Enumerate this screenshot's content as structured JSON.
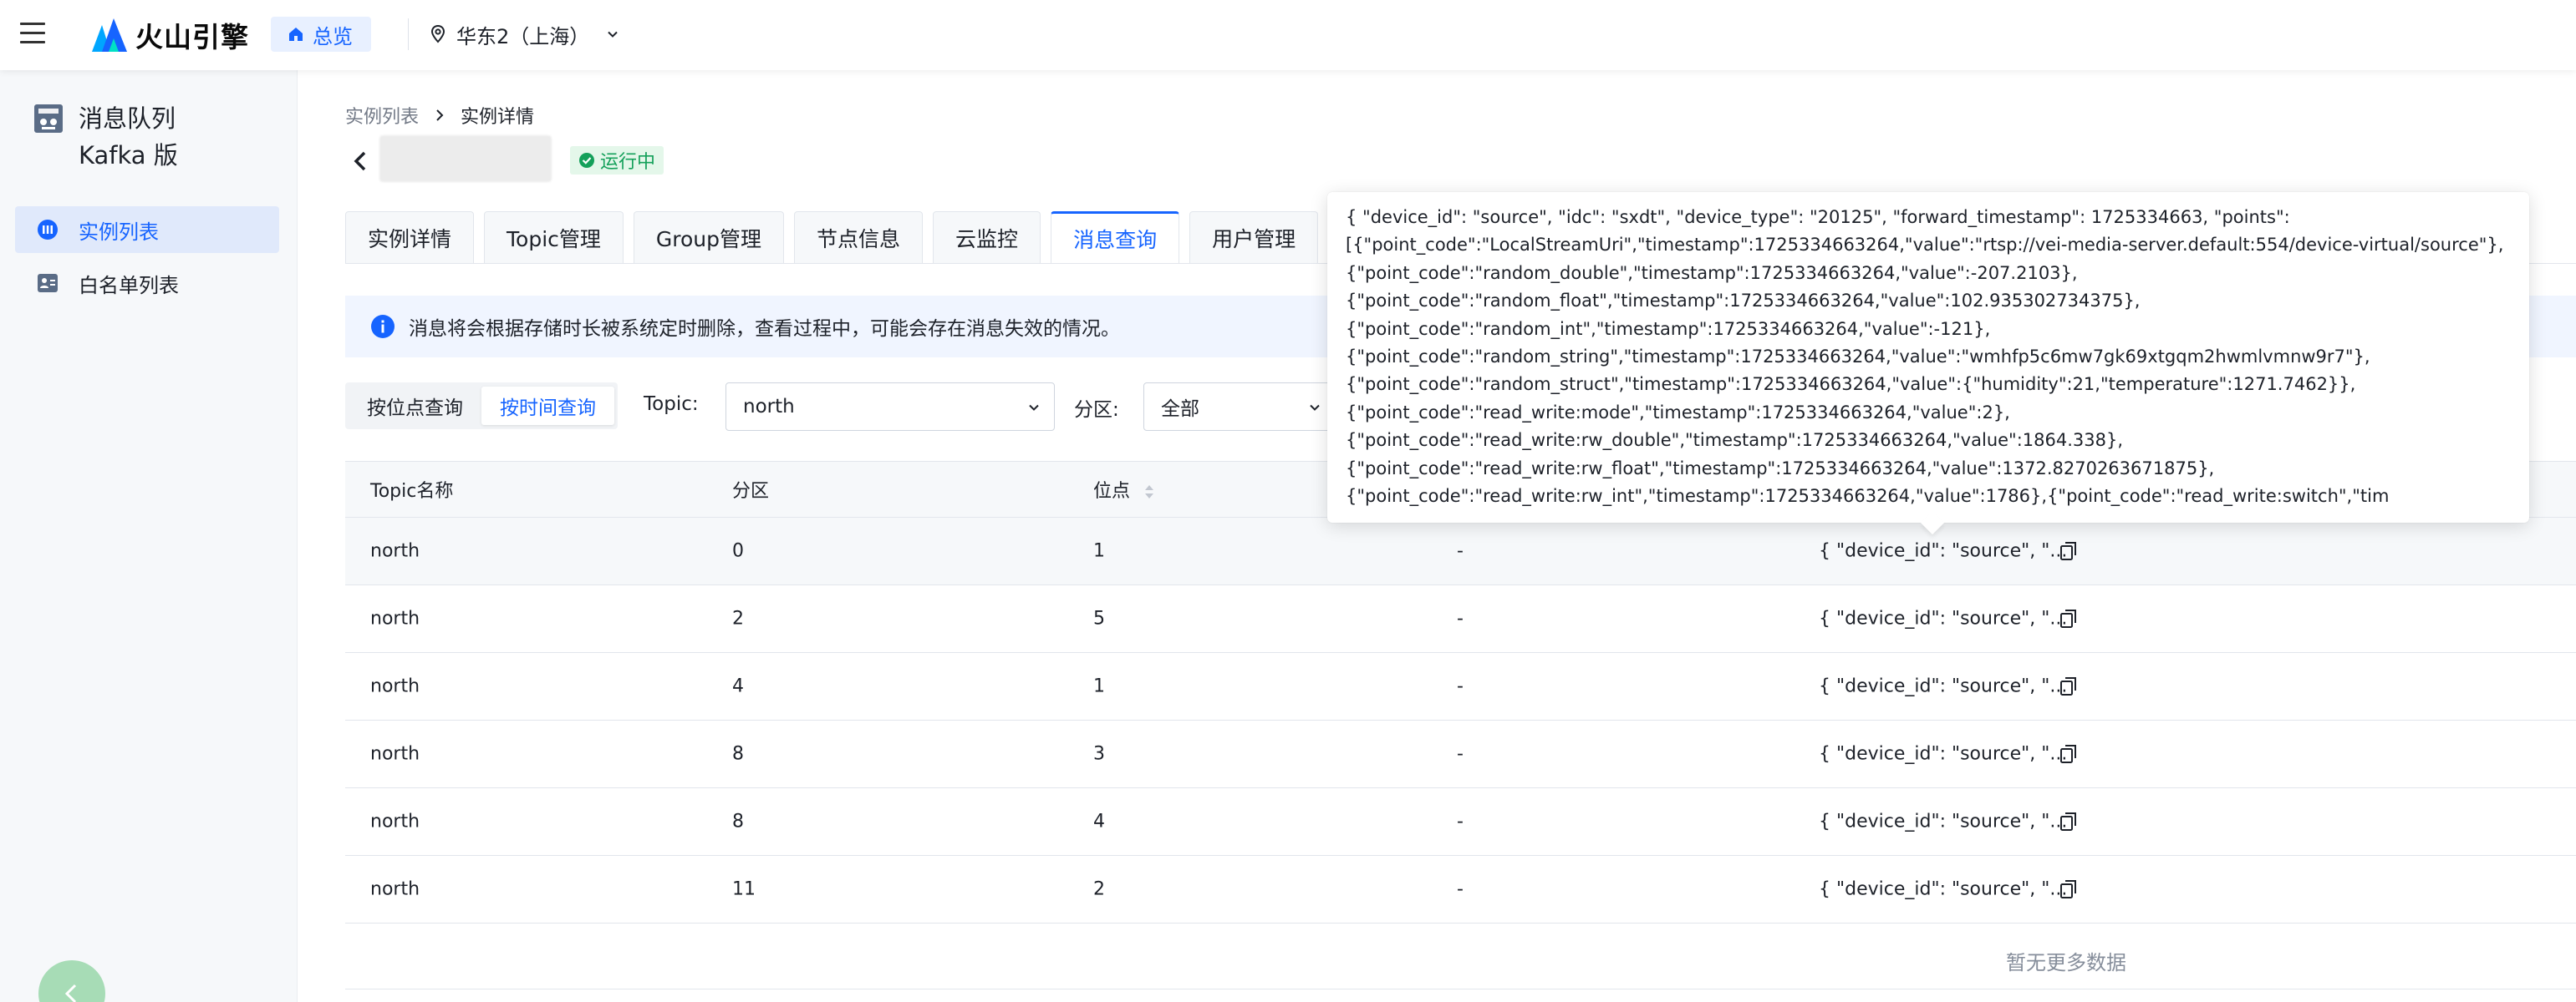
{
  "topbar": {
    "logo_text": "火山引擎",
    "overview_label": "总览",
    "region_label": "华东2（上海）"
  },
  "sidebar": {
    "product_title_line1": "消息队列",
    "product_title_line2": "Kafka 版",
    "items": [
      {
        "label": "实例列表",
        "active": true
      },
      {
        "label": "白名单列表",
        "active": false
      }
    ]
  },
  "breadcrumb": {
    "parent": "实例列表",
    "current": "实例详情"
  },
  "instance": {
    "status": "运行中",
    "status_color": "#14a05a"
  },
  "tabs": [
    {
      "label": "实例详情",
      "active": false
    },
    {
      "label": "Topic管理",
      "active": false
    },
    {
      "label": "Group管理",
      "active": false
    },
    {
      "label": "节点信息",
      "active": false
    },
    {
      "label": "云监控",
      "active": false
    },
    {
      "label": "消息查询",
      "active": true
    },
    {
      "label": "用户管理",
      "active": false
    }
  ],
  "info_notice": "消息将会根据存储时长被系统定时删除，查看过程中，可能会存在消息失效的情况。",
  "query": {
    "mode_by_offset": "按位点查询",
    "mode_by_time": "按时间查询",
    "active_mode": "按时间查询",
    "topic_label": "Topic:",
    "topic_value": "north",
    "partition_label": "分区:",
    "partition_value": "全部"
  },
  "table": {
    "headers": [
      "Topic名称",
      "分区",
      "位点"
    ],
    "rows": [
      {
        "topic": "north",
        "partition": "0",
        "offset": "1",
        "key": "-",
        "value": "{ \"device_id\": \"source\", \"..."
      },
      {
        "topic": "north",
        "partition": "2",
        "offset": "5",
        "key": "-",
        "value": "{ \"device_id\": \"source\", \"..."
      },
      {
        "topic": "north",
        "partition": "4",
        "offset": "1",
        "key": "-",
        "value": "{ \"device_id\": \"source\", \"..."
      },
      {
        "topic": "north",
        "partition": "8",
        "offset": "3",
        "key": "-",
        "value": "{ \"device_id\": \"source\", \"..."
      },
      {
        "topic": "north",
        "partition": "8",
        "offset": "4",
        "key": "-",
        "value": "{ \"device_id\": \"source\", \"..."
      },
      {
        "topic": "north",
        "partition": "11",
        "offset": "2",
        "key": "-",
        "value": "{ \"device_id\": \"source\", \"..."
      }
    ],
    "no_more_text": "暂无更多数据"
  },
  "tooltip": {
    "lines": [
      "{ \"device_id\": \"source\", \"idc\": \"sxdt\", \"device_type\": \"20125\", \"forward_timestamp\": 1725334663, \"points\":",
      "[{\"point_code\":\"LocalStreamUri\",\"timestamp\":1725334663264,\"value\":\"rtsp://vei-media-server.default:554/device-virtual/source\"},",
      "{\"point_code\":\"random_double\",\"timestamp\":1725334663264,\"value\":-207.2103},",
      "{\"point_code\":\"random_float\",\"timestamp\":1725334663264,\"value\":102.935302734375},",
      "{\"point_code\":\"random_int\",\"timestamp\":1725334663264,\"value\":-121},",
      "{\"point_code\":\"random_string\",\"timestamp\":1725334663264,\"value\":\"wmhfp5c6mw7gk69xtgqm2hwmlvmnw9r7\"},",
      "{\"point_code\":\"random_struct\",\"timestamp\":1725334663264,\"value\":{\"humidity\":21,\"temperature\":1271.7462}},",
      "{\"point_code\":\"read_write:mode\",\"timestamp\":1725334663264,\"value\":2},",
      "{\"point_code\":\"read_write:rw_double\",\"timestamp\":1725334663264,\"value\":1864.338},",
      "{\"point_code\":\"read_write:rw_float\",\"timestamp\":1725334663264,\"value\":1372.8270263671875},",
      "{\"point_code\":\"read_write:rw_int\",\"timestamp\":1725334663264,\"value\":1786},{\"point_code\":\"read_write:switch\",\"tim"
    ]
  },
  "colors": {
    "accent": "#1664ff",
    "accent_bg": "#e0e9fb",
    "success": "#14a05a"
  },
  "icons": {
    "menu": "hamburger-icon",
    "logo": "volcano-logo",
    "overview": "home-icon",
    "region": "location-pin-icon",
    "back": "chevron-left-icon",
    "info": "info-icon",
    "copy": "copy-icon",
    "sort": "sort-icon"
  }
}
